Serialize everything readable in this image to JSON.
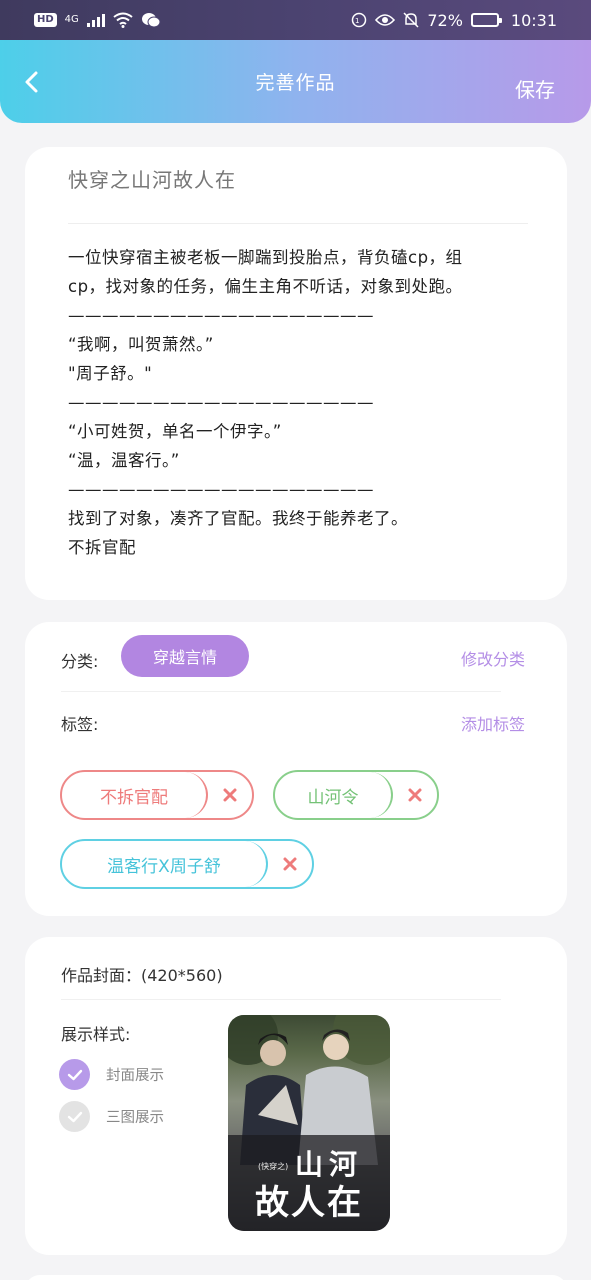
{
  "status_bar": {
    "hd": "HD",
    "network": "4G",
    "battery": "72%",
    "time": "10:31"
  },
  "header": {
    "title": "完善作品",
    "save_label": "保存"
  },
  "work": {
    "title": "快穿之山河故人在",
    "description_lines": [
      "一位快穿宿主被老板一脚踹到投胎点，背负磕cp，组",
      "cp，找对象的任务，偏生主角不听话，对象到处跑。",
      "——————————————————",
      "“我啊，叫贺萧然。”",
      "\"周子舒。\"",
      "——————————————————",
      "“小可姓贺，单名一个伊字。”",
      "“温，温客行。”",
      "——————————————————",
      "找到了对象，凑齐了官配。我终于能养老了。",
      "不拆官配"
    ]
  },
  "category": {
    "label": "分类:",
    "value": "穿越言情",
    "edit_label": "修改分类"
  },
  "tags": {
    "label": "标签:",
    "add_label": "添加标签",
    "items": [
      {
        "text": "不拆官配",
        "color": "#ee8888"
      },
      {
        "text": "山河令",
        "color": "#89cf8b"
      },
      {
        "text": "温客行X周子舒",
        "color": "#5fd0e3"
      }
    ]
  },
  "cover": {
    "label": "作品封面：(420*560)",
    "display_style_label": "展示样式:",
    "options": [
      {
        "label": "封面展示",
        "selected": true
      },
      {
        "label": "三图展示",
        "selected": false
      }
    ],
    "image_title_line1": "山河",
    "image_title_line2": "故人在",
    "image_small_text": "(快穿之)"
  },
  "colors": {
    "accent": "#b286e1",
    "header_gradient_start": "#4dcfe9",
    "header_gradient_end": "#b79ae9"
  }
}
